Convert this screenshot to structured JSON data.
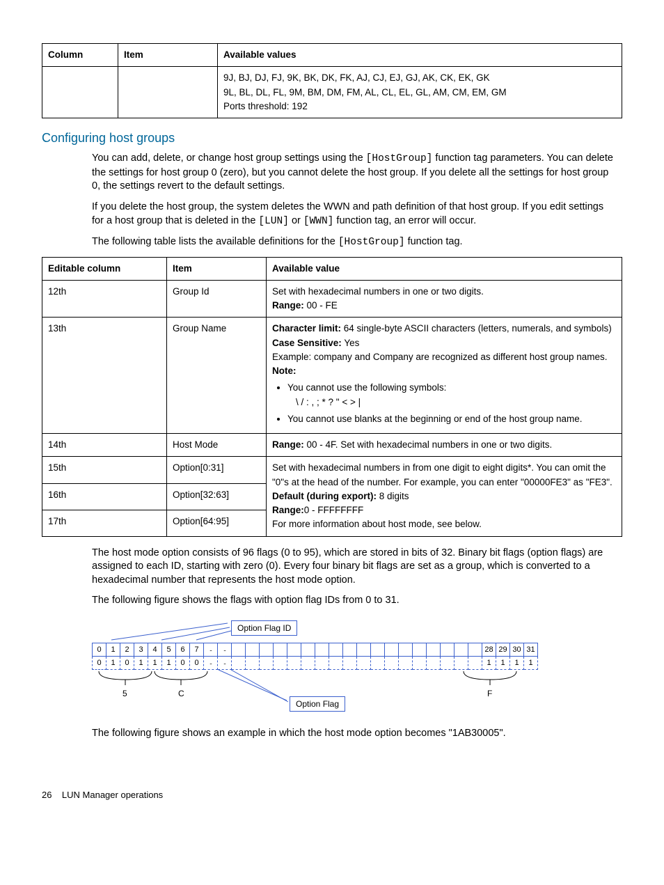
{
  "table1": {
    "headers": [
      "Column",
      "Item",
      "Available values"
    ],
    "row": {
      "col1": "",
      "col2": "",
      "line1": "9J, BJ, DJ, FJ, 9K, BK, DK, FK, AJ, CJ, EJ, GJ, AK, CK, EK, GK",
      "line2": "9L, BL, DL, FL, 9M, BM, DM, FM, AL, CL, EL, GL, AM, CM, EM, GM",
      "line3": "Ports threshold: 192"
    }
  },
  "heading": "Configuring host groups",
  "para1a": "You can add, delete, or change host group settings using the ",
  "para1b": " function tag parameters. You can delete the settings for host group 0 (zero), but you cannot delete the host group. If you delete all the settings for host group 0, the settings revert to the default settings.",
  "para2a": "If you delete the host group, the system deletes the WWN and path definition of that host group. If you edit settings for a host group that is deleted in the ",
  "para2b": " or ",
  "para2c": " function tag, an error will occur.",
  "para3a": "The following table lists the available definitions for the ",
  "para3b": " function tag.",
  "tag_hostgroup": "[HostGroup]",
  "tag_lun": "[LUN]",
  "tag_wwn": "[WWN]",
  "table2": {
    "headers": [
      "Editable column",
      "Item",
      "Available value"
    ],
    "rows": {
      "r1": {
        "c1": "12th",
        "c2": "Group Id",
        "c3_line1": "Set with hexadecimal numbers in one or two digits.",
        "c3_range_label": "Range:",
        "c3_range_val": " 00 - FE"
      },
      "r2": {
        "c1": "13th",
        "c2": "Group Name",
        "charlimit_label": "Character limit:",
        "charlimit_val": " 64 single-byte ASCII characters (letters, numerals, and symbols)",
        "case_label": "Case Sensitive:",
        "case_val": " Yes",
        "example": "Example: company and Company are recognized as different host group names.",
        "note_label": "Note:",
        "bullet1": "You cannot use the following symbols:",
        "symbols": "\\ / : , ; * ? \" < > |",
        "bullet2": "You cannot use blanks at the beginning or end of the host group name."
      },
      "r3": {
        "c1": "14th",
        "c2": "Host Mode",
        "range_label": "Range:",
        "range_val": " 00 - 4F. Set with hexadecimal numbers in one or two digits."
      },
      "r4": {
        "c1": "15th",
        "c2": "Option[0:31]"
      },
      "r5": {
        "c1": "16th",
        "c2": "Option[32:63]"
      },
      "r6": {
        "c1": "17th",
        "c2": "Option[64:95]"
      },
      "merged": {
        "line1": "Set with hexadecimal numbers in from one digit to eight digits*. You can omit the \"0\"s at the head of the number. For example, you can enter \"00000FE3\" as \"FE3\".",
        "default_label": "Default (during export):",
        "default_val": " 8 digits",
        "range_label": "Range:",
        "range_val": "0 - FFFFFFFF",
        "line4": "For more information about host mode, see below."
      }
    }
  },
  "para4": "The host mode option consists of 96 flags (0 to 95), which are stored in bits of 32. Binary bit flags (option flags) are assigned to each ID, starting with zero (0). Every four binary bit flags are set as a group, which is converted to a hexadecimal number that represents the host mode option.",
  "para5": "The following figure shows the flags with option flag IDs from 0 to 31.",
  "figure": {
    "label_top": "Option Flag ID",
    "label_bottom": "Option Flag",
    "row1": [
      "0",
      "1",
      "2",
      "3",
      "4",
      "5",
      "6",
      "7",
      "..",
      "..",
      "",
      "",
      "",
      "",
      "",
      "",
      "",
      "",
      "",
      "",
      "",
      "",
      "",
      "",
      "",
      "",
      "",
      "",
      "28",
      "29",
      "30",
      "31"
    ],
    "row2": [
      "0",
      "1",
      "0",
      "1",
      "1",
      "1",
      "0",
      "0",
      "..",
      "..",
      "",
      "",
      "",
      "",
      "",
      "",
      "",
      "",
      "",
      "",
      "",
      "",
      "",
      "",
      "",
      "",
      "",
      "",
      "1",
      "1",
      "1",
      "1"
    ],
    "hex": [
      "5",
      "C",
      "F"
    ]
  },
  "para6": "The following figure shows an example in which the host mode option becomes \"1AB30005\".",
  "footer": {
    "page": "26",
    "title": "LUN Manager operations"
  }
}
